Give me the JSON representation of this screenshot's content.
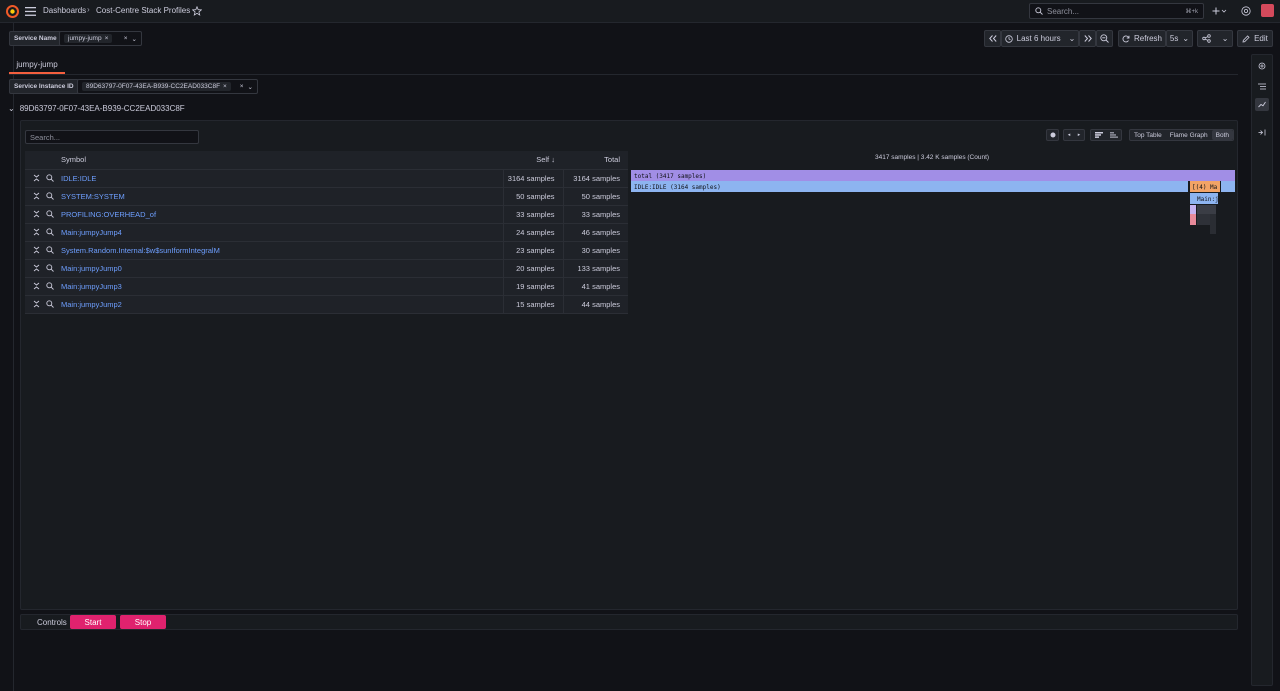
{
  "topbar": {
    "breadcrumb_root": "Dashboards",
    "breadcrumb_sep": "›",
    "breadcrumb_current": "Cost-Centre Stack Profiles",
    "search_placeholder": "Search...",
    "search_shortcut": "⌘+k"
  },
  "variables": {
    "service_name_label": "Service Name",
    "service_name_value": "jumpy-jump",
    "service_instance_label": "Service Instance ID",
    "service_instance_value": "89D63797-0F07-43EA-B939-CC2EAD033C8F"
  },
  "toolbar": {
    "time_range": "Last 6 hours",
    "refresh_label": "Refresh",
    "refresh_interval": "5s",
    "edit_label": "Edit"
  },
  "tabs": [
    {
      "label": "jumpy-jump",
      "active": true
    }
  ],
  "row": {
    "title": "89D63797-0F07-43EA-B939-CC2EAD033C8F"
  },
  "panel": {
    "search_placeholder": "Search...",
    "view_modes": [
      "Top Table",
      "Flame Graph",
      "Both"
    ],
    "active_view": "Both",
    "summary": "3417 samples | 3.42 K samples (Count)",
    "table": {
      "headers": {
        "symbol": "Symbol",
        "self": "Self",
        "total": "Total"
      },
      "sort_indicator": "↓",
      "rows": [
        {
          "symbol": "IDLE:IDLE",
          "self": "3164 samples",
          "total": "3164 samples"
        },
        {
          "symbol": "SYSTEM:SYSTEM",
          "self": "50 samples",
          "total": "50 samples"
        },
        {
          "symbol": "PROFILING:OVERHEAD_of",
          "self": "33 samples",
          "total": "33 samples"
        },
        {
          "symbol": "Main:jumpyJump4",
          "self": "24 samples",
          "total": "46 samples"
        },
        {
          "symbol": "System.Random.Internal:$w$sunIformIntegralM",
          "self": "23 samples",
          "total": "30 samples"
        },
        {
          "symbol": "Main:jumpyJump0",
          "self": "20 samples",
          "total": "133 samples"
        },
        {
          "symbol": "Main:jumpyJump3",
          "self": "19 samples",
          "total": "41 samples"
        },
        {
          "symbol": "Main:jumpyJump2",
          "self": "15 samples",
          "total": "44 samples"
        }
      ]
    },
    "flame": {
      "total_label": "total (3417 samples)",
      "idle_label": "IDLE:IDLE (3164 samples)",
      "side_label_1": "[(4) Ma",
      "side_label_2": "Main:j",
      "colors": {
        "total": "#a18ee6",
        "idle": "#8db4f0",
        "orange": "#f2a366",
        "pink": "#e88a9a"
      }
    }
  },
  "controls": {
    "label": "Controls",
    "start_label": "Start",
    "stop_label": "Stop"
  }
}
